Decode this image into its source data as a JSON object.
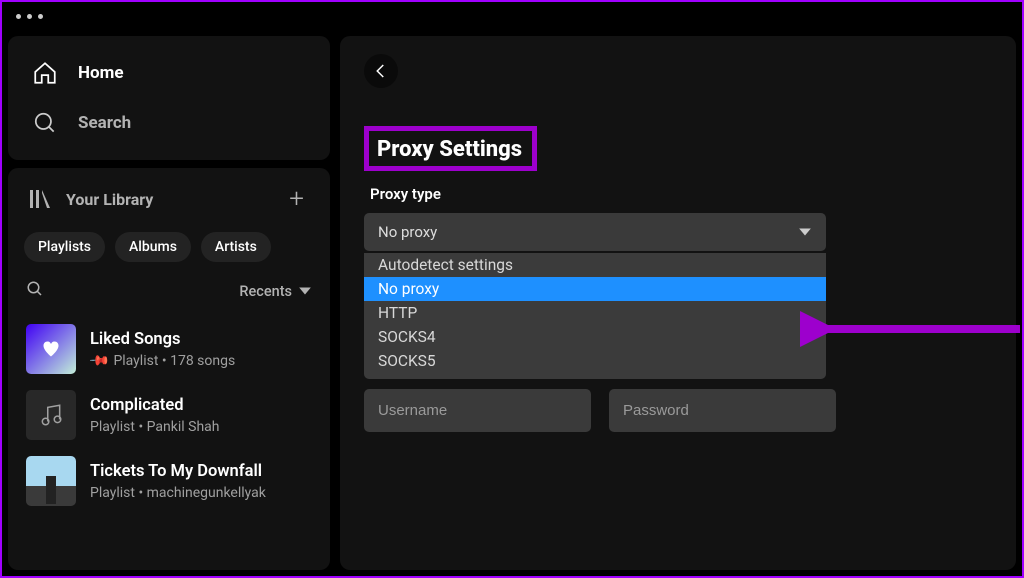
{
  "nav": {
    "home": "Home",
    "search": "Search"
  },
  "library": {
    "title": "Your Library",
    "chips": [
      "Playlists",
      "Albums",
      "Artists"
    ],
    "sort_label": "Recents",
    "items": [
      {
        "title": "Liked Songs",
        "subtitle": "Playlist • 178 songs",
        "pinned": true,
        "art": "liked"
      },
      {
        "title": "Complicated",
        "subtitle": "Playlist • Pankil Shah",
        "pinned": false,
        "art": "note"
      },
      {
        "title": "Tickets To My Downfall",
        "subtitle": "Playlist • machinegunkellyak",
        "pinned": false,
        "art": "tickets"
      }
    ]
  },
  "settings": {
    "heading": "Proxy Settings",
    "proxy_type_label": "Proxy type",
    "proxy_selected": "No proxy",
    "proxy_options": [
      "Autodetect settings",
      "No proxy",
      "HTTP",
      "SOCKS4",
      "SOCKS5"
    ],
    "username_placeholder": "Username",
    "password_placeholder": "Password"
  },
  "annotation": {
    "highlight_color": "#9d00cd",
    "arrow_color": "#9d00cd"
  }
}
